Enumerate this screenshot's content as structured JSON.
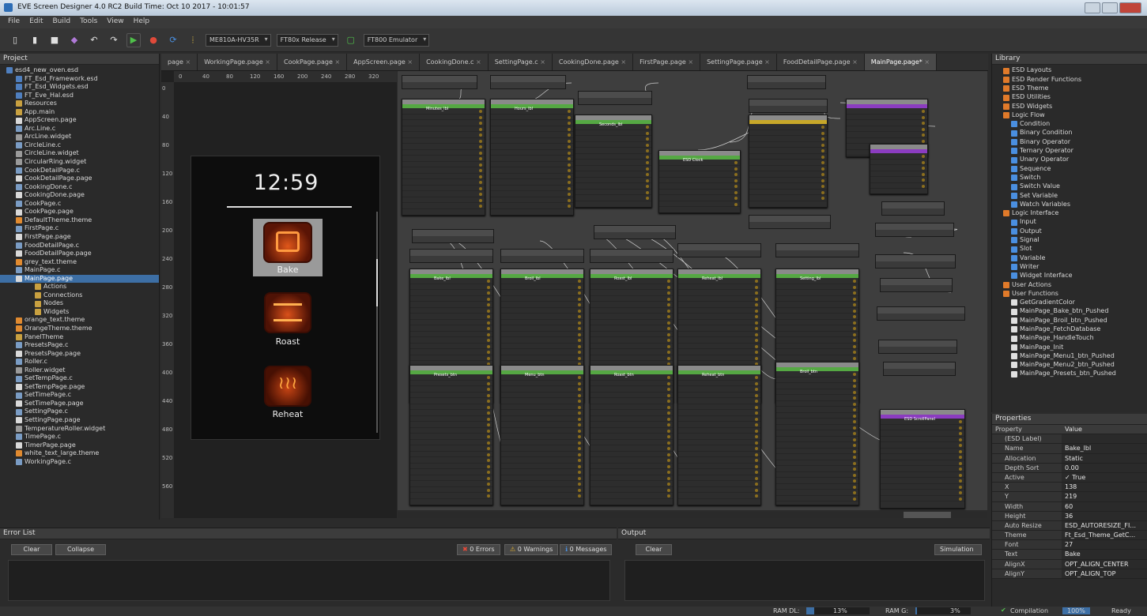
{
  "app": {
    "title": "EVE Screen Designer 4.0 RC2 Build Time: Oct 10 2017 - 10:01:57"
  },
  "menu": [
    "File",
    "Edit",
    "Build",
    "Tools",
    "View",
    "Help"
  ],
  "toolbar": {
    "module": "ME810A-HV35R",
    "build": "FT80x Release",
    "sim": "FT800 Emulator"
  },
  "project": {
    "title": "Project",
    "items": [
      "esd4_new_oven.esd",
      "FT_Esd_Framework.esd",
      "FT_Esd_Widgets.esd",
      "FT_Eve_Hal.esd",
      "Resources",
      "App.main",
      "AppScreen.page",
      "Arc.Line.c",
      "ArcLine.widget",
      "CircleLine.c",
      "CircleLine.widget",
      "CircularRing.widget",
      "CookDetailPage.c",
      "CookDetailPage.page",
      "CookingDone.c",
      "CookingDone.page",
      "CookPage.c",
      "CookPage.page",
      "DefaultTheme.theme",
      "FirstPage.c",
      "FirstPage.page",
      "FoodDetailPage.c",
      "FoodDetailPage.page",
      "grey_text.theme",
      "MainPage.c",
      "MainPage.page",
      "Actions",
      "Connections",
      "Nodes",
      "Widgets",
      "orange_text.theme",
      "OrangeTheme.theme",
      "PanelTheme",
      "PresetsPage.c",
      "PresetsPage.page",
      "Roller.c",
      "Roller.widget",
      "SetTempPage.c",
      "SetTempPage.page",
      "SetTimePage.c",
      "SetTimePage.page",
      "SettingPage.c",
      "SettingPage.page",
      "TemperatureRoller.widget",
      "TimePage.c",
      "TimerPage.page",
      "white_text_large.theme",
      "WorkingPage.c"
    ],
    "selected": "MainPage.page"
  },
  "tabs": [
    "page",
    "WorkingPage.page",
    "CookPage.page",
    "AppScreen.page",
    "CookingDone.c",
    "SettingPage.c",
    "CookingDone.page",
    "FirstPage.page",
    "SettingPage.page",
    "FoodDetailPage.page",
    "MainPage.page*"
  ],
  "ruler": {
    "h": [
      "0",
      "40",
      "80",
      "120",
      "160",
      "200",
      "240",
      "280",
      "320"
    ],
    "v": [
      "0",
      "40",
      "80",
      "120",
      "160",
      "200",
      "240",
      "280",
      "320",
      "360",
      "400",
      "440",
      "480",
      "520",
      "560"
    ]
  },
  "device": {
    "time": "12:59",
    "buttons": [
      "Bake",
      "Roast",
      "Reheat"
    ]
  },
  "library": {
    "title": "Library",
    "items": [
      "ESD Layouts",
      "ESD Render Functions",
      "ESD Theme",
      "ESD Utilities",
      "ESD Widgets",
      "Logic Flow",
      "Condition",
      "Binary Condition",
      "Binary Operator",
      "Ternary Operator",
      "Unary Operator",
      "Sequence",
      "Switch",
      "Switch Value",
      "Set Variable",
      "Watch Variables",
      "Logic Interface",
      "Input",
      "Output",
      "Signal",
      "Slot",
      "Variable",
      "Writer",
      "Widget Interface",
      "User Actions",
      "User Functions",
      "GetGradientColor",
      "MainPage_Bake_btn_Pushed",
      "MainPage_Broil_btn_Pushed",
      "MainPage_FetchDatabase",
      "MainPage_HandleTouch",
      "MainPage_Init",
      "MainPage_Menu1_btn_Pushed",
      "MainPage_Menu2_btn_Pushed",
      "MainPage_Presets_btn_Pushed"
    ]
  },
  "properties": {
    "title": "Properties",
    "header": [
      "Property",
      "Value"
    ],
    "rows": [
      [
        "(ESD Label)",
        ""
      ],
      [
        "Name",
        "Bake_lbl"
      ],
      [
        "Allocation",
        "Static"
      ],
      [
        "Depth Sort",
        "0.00"
      ],
      [
        "Active",
        "✓ True"
      ],
      [
        "X",
        "138"
      ],
      [
        "Y",
        "219"
      ],
      [
        "Width",
        "60"
      ],
      [
        "Height",
        "36"
      ],
      [
        "Auto Resize",
        "ESD_AUTORESIZE_FI..."
      ],
      [
        "Theme",
        "Ft_Esd_Theme_GetC..."
      ],
      [
        "Font",
        "27"
      ],
      [
        "Text",
        "Bake"
      ],
      [
        "AlignX",
        "OPT_ALIGN_CENTER"
      ],
      [
        "AlignY",
        "OPT_ALIGN_TOP"
      ]
    ]
  },
  "errors": {
    "title": "Error List",
    "clear": "Clear",
    "collapse": "Collapse",
    "errors": "0 Errors",
    "warnings": "0 Warnings",
    "messages": "0 Messages"
  },
  "output": {
    "title": "Output",
    "clear": "Clear",
    "filter": "Simulation"
  },
  "status": {
    "ram_dl": "RAM DL:",
    "ram_dl_val": "13%",
    "ram_g": "RAM G:",
    "ram_g_val": "3%",
    "compilation": "Compilation",
    "zoom": "100%",
    "ready": "Ready"
  },
  "logic_nodes": {
    "titles": [
      "Minutes_lbl",
      "Hours_lbl",
      "Seconds_lbl",
      "ESD Clock",
      "Bake_lbl",
      "Broil_lbl",
      "Roast_lbl",
      "Reheat_lbl",
      "Setting_lbl",
      "Presets_btn",
      "Menu_btn",
      "Roast_btn",
      "Reheat_btn",
      "Broil_btn",
      "ESD ScrollPanel"
    ],
    "colors": {
      "green": "#55a843",
      "purple": "#8b3cc0",
      "yellow": "#c7a729"
    }
  }
}
